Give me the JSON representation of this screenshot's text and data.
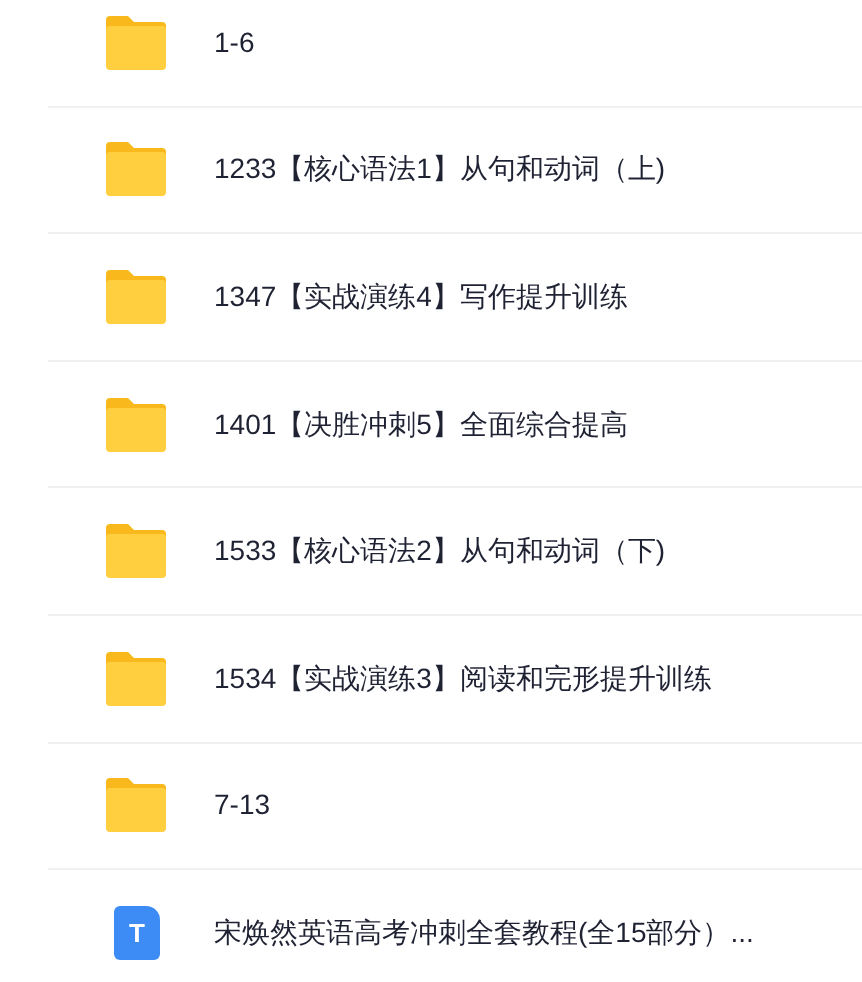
{
  "items": [
    {
      "kind": "folder",
      "name": "1-6"
    },
    {
      "kind": "folder",
      "name": "1233【核心语法1】从句和动词（上)"
    },
    {
      "kind": "folder",
      "name": "1347【实战演练4】写作提升训练"
    },
    {
      "kind": "folder",
      "name": "1401【决胜冲刺5】全面综合提高"
    },
    {
      "kind": "folder",
      "name": "1533【核心语法2】从句和动词（下)"
    },
    {
      "kind": "folder",
      "name": "1534【实战演练3】阅读和完形提升训练"
    },
    {
      "kind": "folder",
      "name": "7-13"
    },
    {
      "kind": "document",
      "name": "宋焕然英语高考冲刺全套教程(全15部分）...",
      "icon_letter": "T"
    }
  ]
}
